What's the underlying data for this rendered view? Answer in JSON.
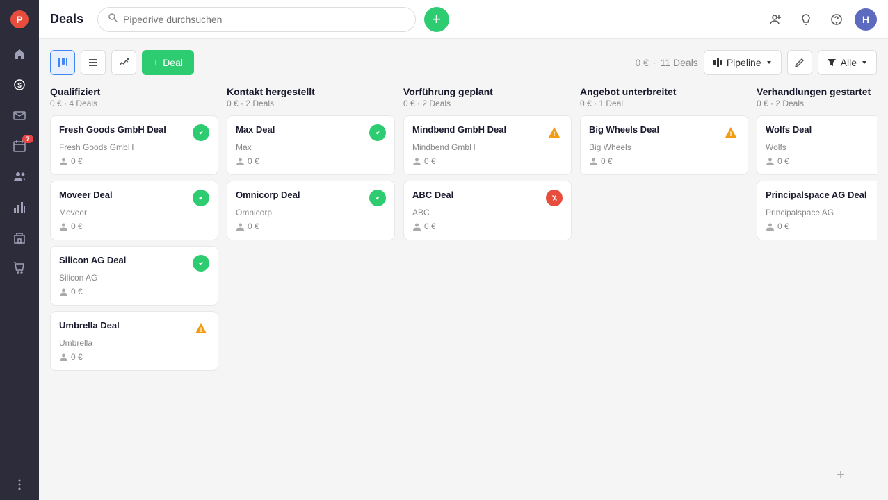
{
  "app": {
    "title": "Deals"
  },
  "topbar": {
    "search_placeholder": "Pipedrive durchsuchen",
    "add_button_label": "+",
    "avatar_label": "H"
  },
  "toolbar": {
    "stats_amount": "0 €",
    "stats_separator": "·",
    "stats_count": "11 Deals",
    "pipeline_label": "Pipeline",
    "filter_label": "Alle",
    "add_deal_label": "Deal"
  },
  "columns": [
    {
      "id": "qualifiziert",
      "title": "Qualifiziert",
      "amount": "0 €",
      "count": "4 Deals",
      "cards": [
        {
          "name": "Fresh Goods GmbH Deal",
          "company": "Fresh Goods GmbH",
          "amount": "0 €",
          "status": "green"
        },
        {
          "name": "Moveer Deal",
          "company": "Moveer",
          "amount": "0 €",
          "status": "green"
        },
        {
          "name": "Silicon AG Deal",
          "company": "Silicon AG",
          "amount": "0 €",
          "status": "green"
        },
        {
          "name": "Umbrella Deal",
          "company": "Umbrella",
          "amount": "0 €",
          "status": "yellow"
        }
      ]
    },
    {
      "id": "kontakt",
      "title": "Kontakt hergestellt",
      "amount": "0 €",
      "count": "2 Deals",
      "cards": [
        {
          "name": "Max Deal",
          "company": "Max",
          "amount": "0 €",
          "status": "green"
        },
        {
          "name": "Omnicorp Deal",
          "company": "Omnicorp",
          "amount": "0 €",
          "status": "green"
        }
      ]
    },
    {
      "id": "vorfuehrung",
      "title": "Vorführung geplant",
      "amount": "0 €",
      "count": "2 Deals",
      "cards": [
        {
          "name": "Mindbend GmbH Deal",
          "company": "Mindbend GmbH",
          "amount": "0 €",
          "status": "yellow"
        },
        {
          "name": "ABC Deal",
          "company": "ABC",
          "amount": "0 €",
          "status": "red"
        }
      ]
    },
    {
      "id": "angebot",
      "title": "Angebot unterbreitet",
      "amount": "0 €",
      "count": "1 Deal",
      "cards": [
        {
          "name": "Big Wheels Deal",
          "company": "Big Wheels",
          "amount": "0 €",
          "status": "yellow"
        }
      ]
    },
    {
      "id": "verhandlungen",
      "title": "Verhandlungen gestartet",
      "amount": "0 €",
      "count": "2 Deals",
      "cards": [
        {
          "name": "Wolfs Deal",
          "company": "Wolfs",
          "amount": "0 €",
          "status": "red"
        },
        {
          "name": "Principalspace AG Deal",
          "company": "Principalspace AG",
          "amount": "0 €",
          "status": "yellow"
        }
      ]
    }
  ],
  "sidebar": {
    "items": [
      {
        "icon": "🏠",
        "label": "Home",
        "active": false
      },
      {
        "icon": "$",
        "label": "Deals",
        "active": true
      },
      {
        "icon": "📧",
        "label": "Mail",
        "active": false
      },
      {
        "icon": "📅",
        "label": "Calendar",
        "active": false,
        "badge": "7"
      },
      {
        "icon": "📊",
        "label": "Contacts",
        "active": false
      },
      {
        "icon": "📈",
        "label": "Reports",
        "active": false
      },
      {
        "icon": "🏢",
        "label": "Companies",
        "active": false
      },
      {
        "icon": "🛒",
        "label": "Products",
        "active": false
      },
      {
        "icon": "⚙️",
        "label": "More",
        "active": false
      }
    ]
  }
}
